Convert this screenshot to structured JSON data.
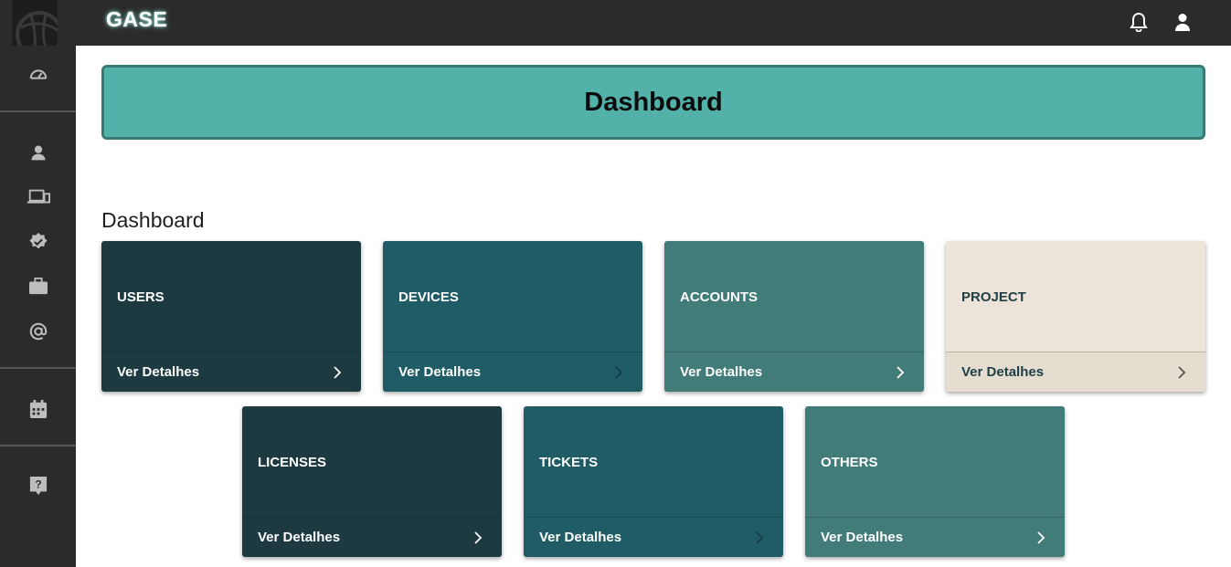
{
  "app": {
    "brand": "GASE"
  },
  "sidebar": {
    "icons": [
      "speedometer-icon",
      "user-icon",
      "devices-icon",
      "verified-badge-icon",
      "briefcase-icon",
      "at-sign-icon",
      "calendar-icon",
      "help-icon"
    ]
  },
  "topbar": {
    "icons": [
      "bell-icon",
      "user-icon"
    ]
  },
  "banner": {
    "title": "Dashboard"
  },
  "section": {
    "title": "Dashboard"
  },
  "cards": [
    {
      "title": "USERS",
      "action": "Ver Detalhes",
      "color": "#1c3a40"
    },
    {
      "title": "DEVICES",
      "action": "Ver Detalhes",
      "color": "#1f5c65"
    },
    {
      "title": "ACCOUNTS",
      "action": "Ver Detalhes",
      "color": "#417c79"
    },
    {
      "title": "PROJECT",
      "action": "Ver Detalhes",
      "color": "#ece4d9"
    },
    {
      "title": "LICENSES",
      "action": "Ver Detalhes",
      "color": "#1c3a40"
    },
    {
      "title": "TICKETS",
      "action": "Ver Detalhes",
      "color": "#1f5c65"
    },
    {
      "title": "OTHERS",
      "action": "Ver Detalhes",
      "color": "#417c79"
    }
  ],
  "colors": {
    "sidebar": "#2b2b2b",
    "banner": "#52b2aa",
    "banner_border": "#3a7a74"
  }
}
